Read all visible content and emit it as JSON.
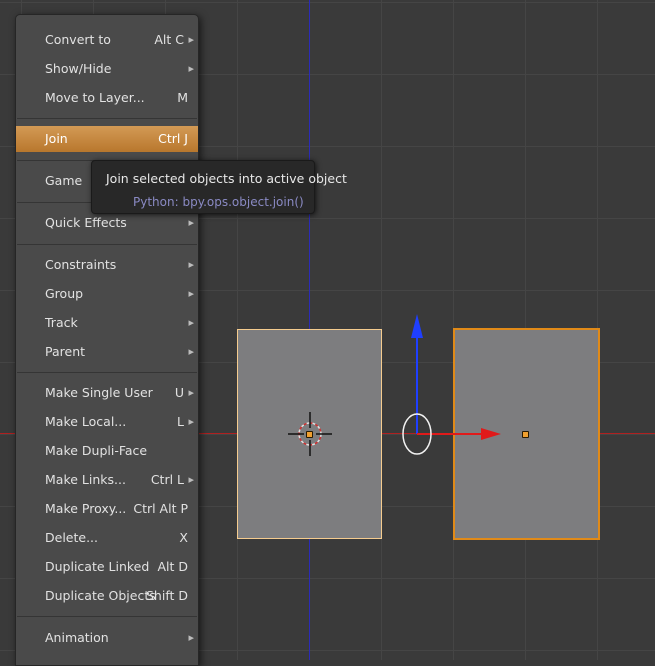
{
  "menu": {
    "items": [
      {
        "label": "Convert to",
        "shortcut": "Alt C",
        "submenu": true
      },
      {
        "label": "Show/Hide",
        "shortcut": "",
        "submenu": true
      },
      {
        "label": "Move to Layer...",
        "shortcut": "M",
        "submenu": false
      },
      {
        "label": "Join",
        "shortcut": "Ctrl J",
        "submenu": false,
        "active": true
      },
      {
        "label": "Game",
        "shortcut": "",
        "submenu": true
      },
      {
        "label": "Quick Effects",
        "shortcut": "",
        "submenu": true
      },
      {
        "label": "Constraints",
        "shortcut": "",
        "submenu": true
      },
      {
        "label": "Group",
        "shortcut": "",
        "submenu": true
      },
      {
        "label": "Track",
        "shortcut": "",
        "submenu": true
      },
      {
        "label": "Parent",
        "shortcut": "",
        "submenu": true
      },
      {
        "label": "Make Single User",
        "shortcut": "U",
        "submenu": true
      },
      {
        "label": "Make Local...",
        "shortcut": "L",
        "submenu": true
      },
      {
        "label": "Make Dupli-Face",
        "shortcut": "",
        "submenu": false
      },
      {
        "label": "Make Links...",
        "shortcut": "Ctrl L",
        "submenu": true
      },
      {
        "label": "Make Proxy...",
        "shortcut": "Ctrl Alt P",
        "submenu": false
      },
      {
        "label": "Delete...",
        "shortcut": "X",
        "submenu": false
      },
      {
        "label": "Duplicate Linked",
        "shortcut": "Alt D",
        "submenu": false
      },
      {
        "label": "Duplicate Objects",
        "shortcut": "Shift D",
        "submenu": false
      },
      {
        "label": "Animation",
        "shortcut": "",
        "submenu": true
      }
    ]
  },
  "tooltip": {
    "description": "Join selected objects into active object",
    "python": "Python: bpy.ops.object.join()"
  },
  "colors": {
    "highlight": "#c8893f",
    "selected_outline": "#e08a18",
    "active_outline": "#f5cc8f",
    "x_axis": "#b02020",
    "z_axis": "#2b2bb8"
  },
  "icons": {
    "submenu_arrow": "chevron-right-icon",
    "cursor": "3d-cursor-icon",
    "gizmo": "transform-manipulator-icon"
  }
}
